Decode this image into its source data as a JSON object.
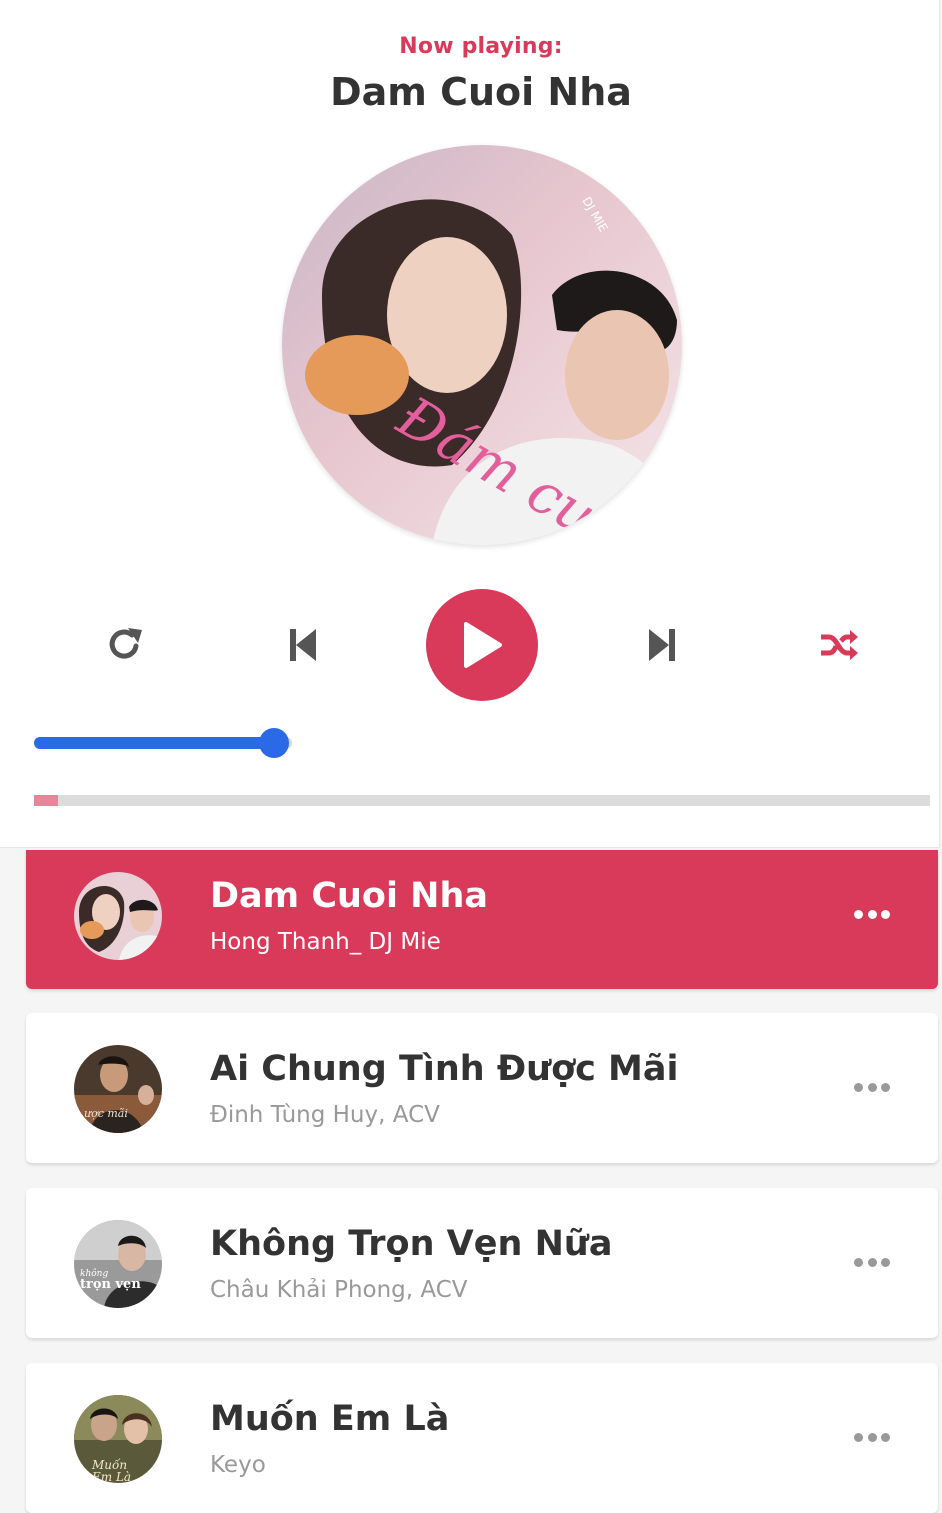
{
  "header": {
    "now_playing_label": "Now playing:",
    "current_song_title": "Dam Cuoi Nha"
  },
  "cover": {
    "current_art_text": "Đám cưới nha",
    "current_art_credit": "DJ MIE"
  },
  "controls": {
    "repeat_icon": "repeat-icon",
    "prev_icon": "step-backward-icon",
    "play_icon": "play-icon",
    "next_icon": "step-forward-icon",
    "random_icon": "random-icon",
    "random_active": true,
    "accent_color": "#d93a5a"
  },
  "volume": {
    "level_fraction": 0.93,
    "color": "#2b6ae6"
  },
  "progress": {
    "fraction": 0.027,
    "color": "#e8859a"
  },
  "playlist": [
    {
      "title": "Dam Cuoi Nha",
      "author": "Hong Thanh_ DJ Mie",
      "active": true
    },
    {
      "title": "Ai Chung Tình Được Mãi",
      "author": "Đinh Tùng Huy, ACV",
      "active": false
    },
    {
      "title": "Không Trọn Vẹn Nữa",
      "author": "Châu Khải Phong, ACV",
      "active": false
    },
    {
      "title": "Muốn Em Là",
      "author": "Keyo",
      "active": false
    }
  ]
}
